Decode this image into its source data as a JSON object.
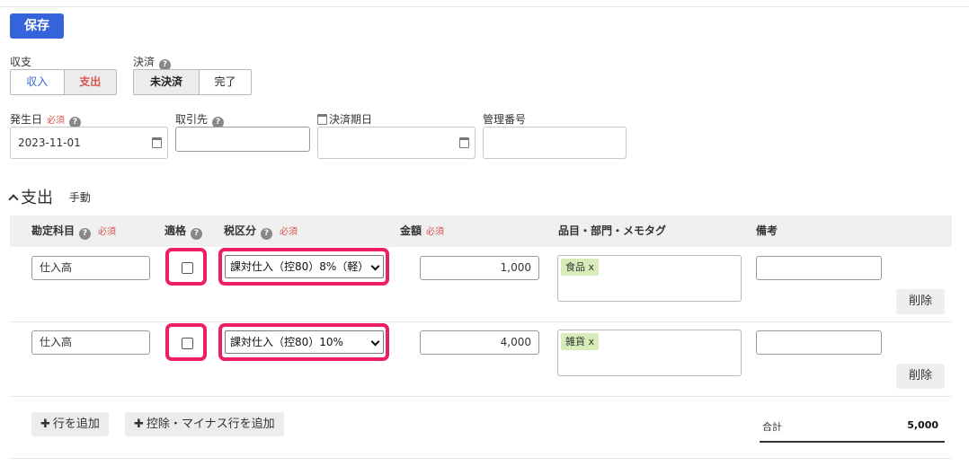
{
  "toolbar": {
    "save_label": "保存"
  },
  "shushi": {
    "label": "収支",
    "options": [
      "収入",
      "支出"
    ],
    "selected": "支出"
  },
  "kessai": {
    "label": "決済",
    "options": [
      "未決済",
      "完了"
    ],
    "selected": "未決済"
  },
  "fields": {
    "hasseibi": {
      "label": "発生日",
      "required": "必須",
      "value": "2023-11-01"
    },
    "torihikisaki": {
      "label": "取引先",
      "value": ""
    },
    "kessai_kijitsu": {
      "label": "決済期日",
      "value": ""
    },
    "kanri_bangou": {
      "label": "管理番号",
      "value": ""
    }
  },
  "section": {
    "title": "支出",
    "mode": "手動"
  },
  "table": {
    "headers": {
      "account": "勘定科目",
      "account_req": "必須",
      "qualified": "適格",
      "tax": "税区分",
      "tax_req": "必須",
      "amount": "金額",
      "amount_req": "必須",
      "tags": "品目・部門・メモタグ",
      "note": "備考"
    },
    "rows": [
      {
        "account": "仕入高",
        "qualified": false,
        "tax": "課対仕入（控80）8%（軽）",
        "amount": "1,000",
        "tag": "食品 x",
        "note": "",
        "delete": "削除"
      },
      {
        "account": "仕入高",
        "qualified": false,
        "tax": "課対仕入（控80）10%",
        "amount": "4,000",
        "tag": "雑貨 x",
        "note": "",
        "delete": "削除"
      }
    ]
  },
  "footer": {
    "add_row": "行を追加",
    "add_deduction_row": "控除・マイナス行を追加",
    "total_label": "合計",
    "total_value": "5,000"
  },
  "icons": {
    "help": "question-circle-icon",
    "calendar": "calendar-icon",
    "chevron": "chevron-up-icon",
    "plus": "plus-icon",
    "select_arrow": "chevron-down-icon"
  },
  "colors": {
    "primary": "#3563d9",
    "expense_red": "#d9534f",
    "income_blue": "#3563d9",
    "highlight": "#ee1f60",
    "tag_green": "#d7ecb9"
  }
}
